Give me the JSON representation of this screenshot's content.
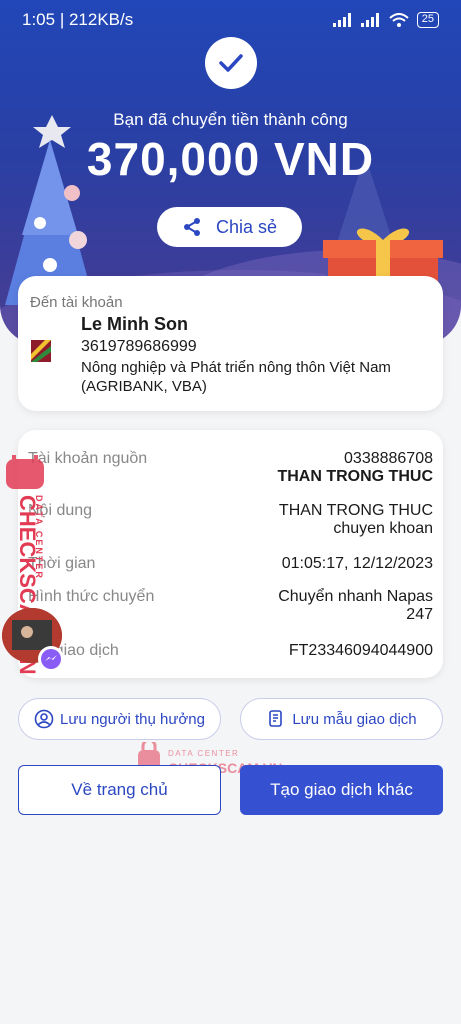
{
  "status_bar": {
    "time": "1:05",
    "speed": "212KB/s",
    "battery": "25"
  },
  "hero": {
    "success_text": "Bạn đã chuyển tiền thành công",
    "amount": "370,000 VND",
    "share_label": "Chia sẻ"
  },
  "recipient": {
    "label": "Đến tài khoản",
    "name": "Le Minh Son",
    "account_number": "3619789686999",
    "bank_name": "Nông nghiệp và Phát triển nông thôn Việt Nam (AGRIBANK, VBA)"
  },
  "details": {
    "source_label": "Tài khoản nguồn",
    "source_account": "0338886708",
    "source_name": "THAN TRONG THUC",
    "content_label": "Nội dung",
    "content_line1": "THAN TRONG THUC",
    "content_line2": "chuyen khoan",
    "time_label": "Thời gian",
    "time_value": "01:05:17, 12/12/2023",
    "method_label": "Hình thức chuyển",
    "method_line1": "Chuyển nhanh Napas",
    "method_line2": "247",
    "txid_label": "Mã giao dịch",
    "txid_value": "FT23346094044900"
  },
  "actions": {
    "save_beneficiary": "Lưu người thụ hưởng",
    "save_template": "Lưu mẫu giao dịch",
    "home": "Về trang chủ",
    "new_transaction": "Tạo giao dịch khác"
  },
  "watermark": {
    "line1": "DATA CENTER",
    "line2": "CHECKSCAM.VN"
  },
  "colors": {
    "primary": "#2c47c2",
    "hero_top": "#2147b8",
    "hero_bottom": "#4a3f8f",
    "watermark": "#e23b54"
  }
}
